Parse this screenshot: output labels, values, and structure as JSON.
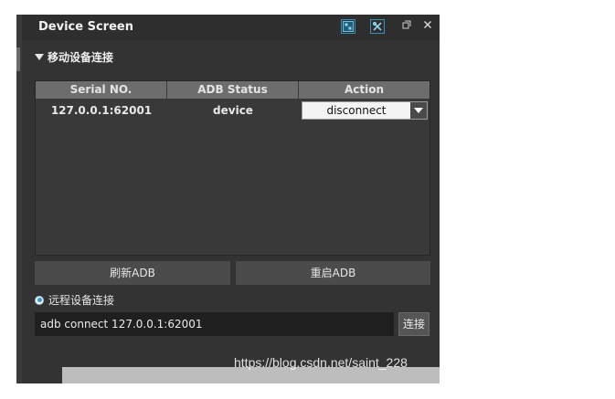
{
  "window": {
    "title": "Device Screen",
    "icons": [
      "screenshot-icon",
      "tools-icon",
      "restore-icon",
      "close-icon"
    ]
  },
  "mobile_section": {
    "title": "移动设备连接"
  },
  "table": {
    "headers": [
      "Serial NO.",
      "ADB Status",
      "Action"
    ],
    "rows": [
      {
        "serial": "127.0.0.1:62001",
        "status": "device",
        "action": "disconnect"
      }
    ]
  },
  "buttons": {
    "refresh_adb": "刷新ADB",
    "restart_adb": "重启ADB"
  },
  "remote_section": {
    "label": "远程设备连接",
    "command_value": "adb connect 127.0.0.1:62001",
    "connect_label": "连接"
  },
  "watermark": "https://blog.csdn.net/saint_228",
  "colors": {
    "panel_bg": "#333333",
    "header_bg": "#6d6d6d",
    "accent": "#3b9bd0"
  }
}
